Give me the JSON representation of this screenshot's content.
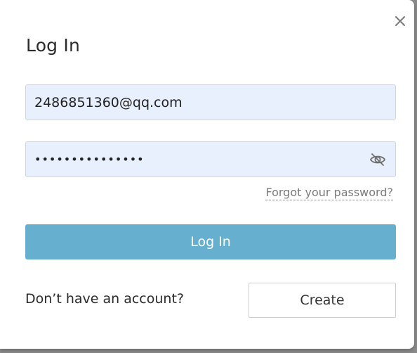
{
  "modal": {
    "title": "Log In",
    "email": {
      "value": "2486851360@qq.com"
    },
    "password": {
      "value": "•••••••••••••••"
    },
    "forgot_label": "Forgot your password?",
    "login_label": "Log In",
    "no_account_label": "Don’t have an account?",
    "create_label": "Create",
    "icons": {
      "close": "close-icon",
      "password_visibility": "eye-off-icon"
    },
    "colors": {
      "primary_button": "#66afcf",
      "input_background": "#e8f0fe"
    }
  }
}
